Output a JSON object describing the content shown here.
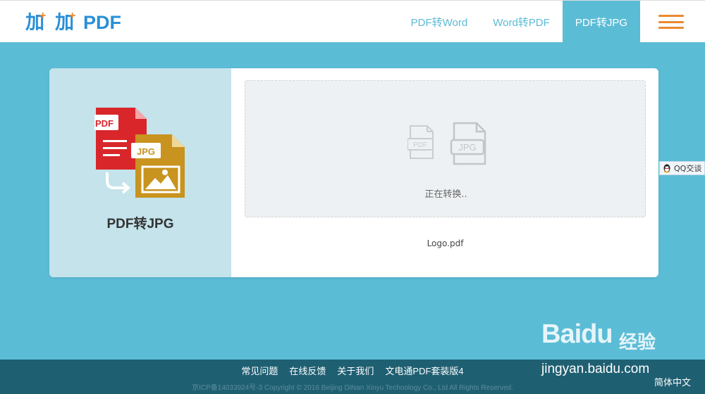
{
  "header": {
    "logo_text": "加加PDF",
    "nav": [
      {
        "label": "PDF转Word"
      },
      {
        "label": "Word转PDF"
      },
      {
        "label": "PDF转JPG"
      }
    ]
  },
  "converter": {
    "title": "PDF转JPG",
    "source_badge": "PDF",
    "target_badge": "JPG",
    "status": "正在转换..",
    "file_name": "Logo.pdf"
  },
  "qq": {
    "label": "QQ交谈"
  },
  "footer": {
    "links": [
      {
        "label": "常见问题"
      },
      {
        "label": "在线反馈"
      },
      {
        "label": "关于我们"
      },
      {
        "label": "文电通PDF套装版4"
      }
    ],
    "copyright": "京ICP备14033924号-3 Copyright © 2016 Beijing DiNan Xinyu Technology Co., Ltd All Rights Reserved.",
    "lang": "简体中文"
  },
  "watermark": {
    "brand": "Baidu",
    "subbrand": "经验",
    "url": "jingyan.baidu.com"
  },
  "colors": {
    "accent": "#5bbcd6",
    "orange": "#e98a30",
    "footer_bg": "#1f5f72"
  }
}
